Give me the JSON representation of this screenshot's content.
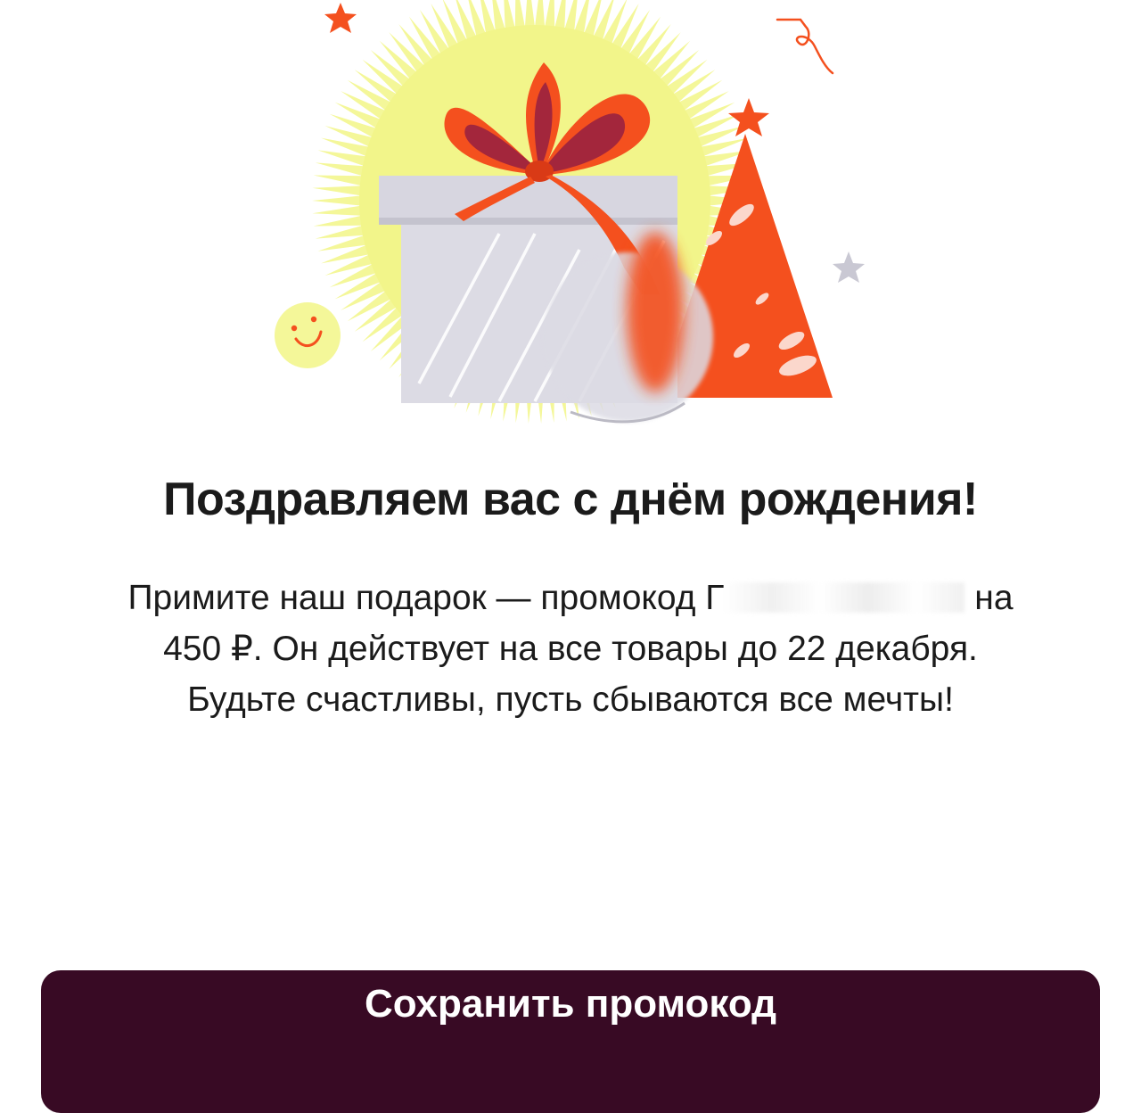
{
  "title": "Поздравляем вас с днём рождения!",
  "message": {
    "line1_start": "Примите наш подарок — промокод Г",
    "line1_end": "на",
    "line2": "450 ₽. Он действует на все товары до 22 декабря.",
    "line3": "Будьте счастливы, пусть сбываются все мечты!"
  },
  "button": {
    "label": "Сохранить промокод"
  },
  "colors": {
    "button_bg": "#380a24",
    "accent_orange": "#f4501e",
    "ribbon_dark": "#a3263c",
    "sun_yellow": "#f4f799",
    "gift_gray": "#d9d8e2"
  },
  "icons": [
    "sun-burst",
    "gift-box",
    "ribbon-bow",
    "party-hat",
    "star",
    "smiley",
    "confetti-squiggle",
    "blurred-coin"
  ]
}
